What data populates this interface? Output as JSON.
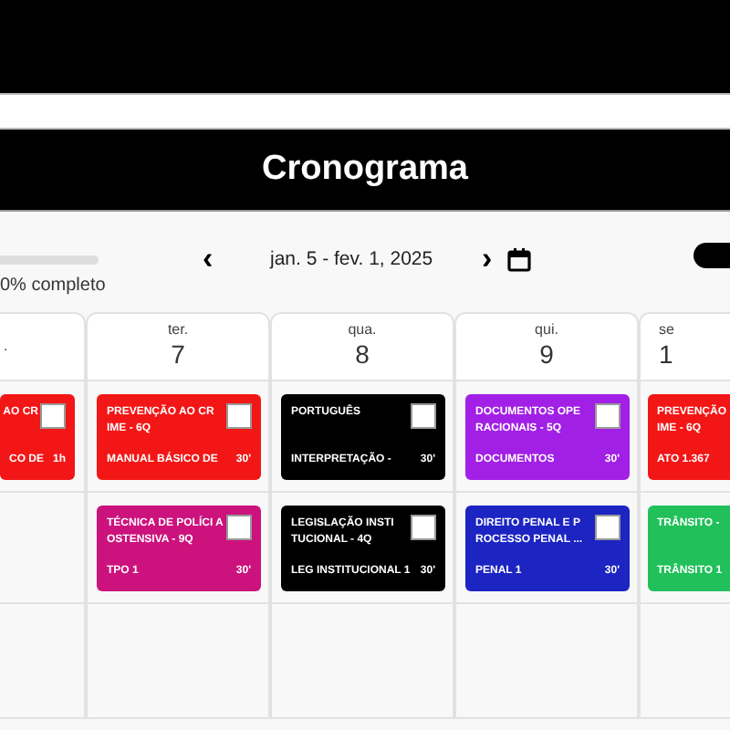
{
  "header": {
    "title": "Cronograma"
  },
  "progress": {
    "level": 0,
    "label": "0% completo"
  },
  "nav": {
    "prev": "‹",
    "range": "jan. 5 - fev. 1, 2025",
    "next": "›"
  },
  "days": [
    {
      "weekday": ".",
      "cells": [
        {
          "kind": "task",
          "title": "AO CR",
          "subject": "CO DE",
          "duration": "1h",
          "color": "#f31616",
          "checked": false
        },
        {
          "kind": "empty"
        },
        {
          "kind": "empty"
        }
      ]
    },
    {
      "weekday": "ter.",
      "day": "7",
      "cells": [
        {
          "kind": "task",
          "title": "PREVENÇÃO AO CR IME - 6Q",
          "subject": "MANUAL BÁSICO DE",
          "duration": "30'",
          "color": "#f31616",
          "checked": false
        },
        {
          "kind": "task",
          "title": "TÉCNICA DE POLÍCI A OSTENSIVA - 9Q",
          "subject": "TPO 1",
          "duration": "30'",
          "color": "#cc127c",
          "checked": false
        },
        {
          "kind": "empty"
        }
      ]
    },
    {
      "weekday": "qua.",
      "day": "8",
      "cells": [
        {
          "kind": "task",
          "title": "PORTUGUÊS",
          "subject": "INTERPRETAÇÃO -",
          "duration": "30'",
          "color": "#000000",
          "checked": false
        },
        {
          "kind": "task",
          "title": "LEGISLAÇÃO INSTI TUCIONAL - 4Q",
          "subject": "LEG INSTITUCIONAL 1",
          "duration": "30'",
          "color": "#000000",
          "checked": false
        },
        {
          "kind": "empty"
        }
      ]
    },
    {
      "weekday": "qui.",
      "day": "9",
      "cells": [
        {
          "kind": "task",
          "title": "DOCUMENTOS OPE RACIONAIS - 5Q",
          "subject": "DOCUMENTOS",
          "duration": "30'",
          "color": "#a21fe6",
          "checked": false
        },
        {
          "kind": "task",
          "title": "DIREITO PENAL E P ROCESSO PENAL ...",
          "subject": "PENAL 1",
          "duration": "30'",
          "color": "#1c24c2",
          "checked": false
        },
        {
          "kind": "empty"
        }
      ]
    },
    {
      "weekday": "se",
      "day": "1",
      "cells": [
        {
          "kind": "task",
          "title": "PREVENÇÃO IME - 6Q",
          "subject": "ATO 1.367",
          "color": "#f31616"
        },
        {
          "kind": "task",
          "title": "TRÂNSITO -",
          "subject": "TRÂNSITO 1",
          "color": "#21c05a"
        },
        {
          "kind": "empty"
        }
      ]
    }
  ]
}
